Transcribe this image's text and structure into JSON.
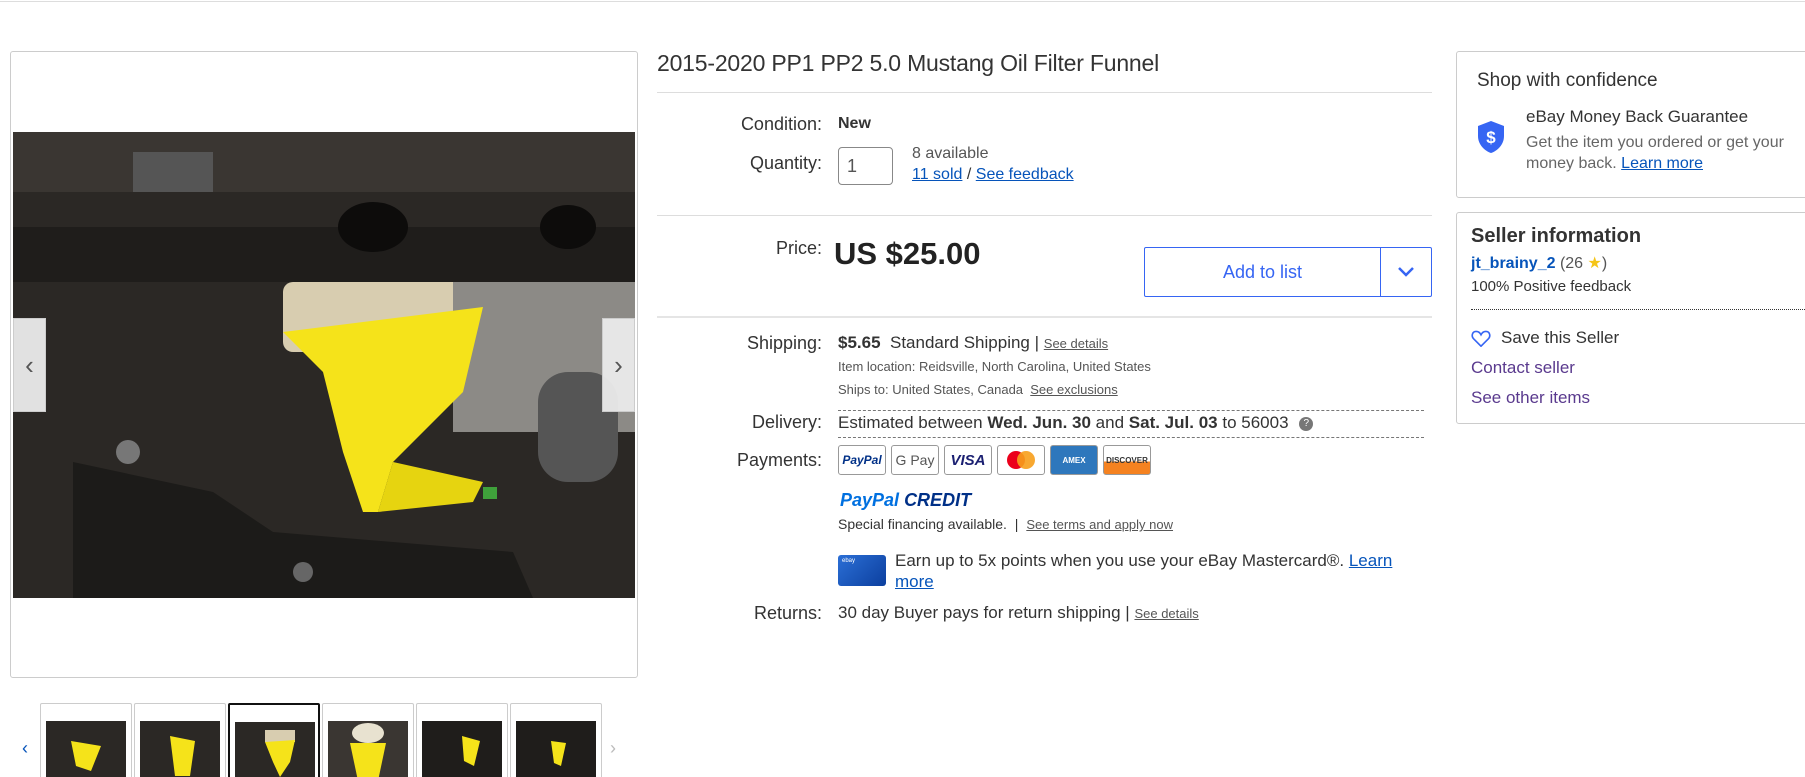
{
  "product": {
    "title": "2015-2020 PP1 PP2 5.0 Mustang Oil Filter Funnel",
    "condition_label": "Condition:",
    "condition_value": "New",
    "quantity_label": "Quantity:",
    "quantity_value": "1",
    "available_text": "8 available",
    "sold_link": "11 sold",
    "slash": "/",
    "feedback_link": "See feedback",
    "price_label": "Price:",
    "price": "US $25.00",
    "add_to_list": "Add to list"
  },
  "shipping": {
    "label": "Shipping:",
    "cost": "$5.65",
    "method": "Standard Shipping",
    "divider": "|",
    "details_link": "See details",
    "location_label": "Item location:",
    "location": "Reidsville, North Carolina, United States",
    "ships_label": "Ships to:",
    "ships_to": "United States, Canada",
    "exclusions_link": "See exclusions"
  },
  "delivery": {
    "label": "Delivery:",
    "prefix": "Estimated between",
    "start": "Wed. Jun. 30",
    "and": "and",
    "end": "Sat. Jul. 03",
    "to": "to 56003",
    "help": "?"
  },
  "payments": {
    "label": "Payments:",
    "methods": [
      "PayPal",
      "G Pay",
      "VISA",
      "Mastercard",
      "AMEX",
      "DISCOVER"
    ],
    "paypal_credit": "PayPal",
    "paypal_credit_suffix": "CREDIT",
    "financing": "Special financing available.",
    "financing_divider": "|",
    "terms_link": "See terms and apply now",
    "mastercard_card_label": "ebay",
    "mastercard_text": "Earn up to 5x points when you use your eBay Mastercard®.",
    "learn_more": "Learn more"
  },
  "returns": {
    "label": "Returns:",
    "text": "30 day Buyer pays for return shipping",
    "divider": "|",
    "details_link": "See details"
  },
  "confidence": {
    "heading": "Shop with confidence",
    "guarantee_title": "eBay Money Back Guarantee",
    "guarantee_text": "Get the item you ordered or get your money back.",
    "learn_more": "Learn more",
    "shield_glyph": "$"
  },
  "seller": {
    "heading": "Seller information",
    "name": "jt_brainy_2",
    "score": "(26",
    "score_close": ")",
    "feedback": "100% Positive feedback",
    "save": "Save this Seller",
    "contact": "Contact seller",
    "other": "See other items"
  },
  "gallery": {
    "prev": "‹",
    "next": "›",
    "thumb_prev": "‹",
    "thumb_next": "›",
    "active_thumb": 2
  },
  "colors": {
    "link": "#0654ba",
    "accent": "#3665f3",
    "funnel": "#f5e31a",
    "star": "#f5c518"
  },
  "icons": [
    "chevron-left-icon",
    "chevron-right-icon",
    "chevron-down-icon",
    "help-icon",
    "shield-dollar-icon",
    "star-icon",
    "heart-icon"
  ]
}
